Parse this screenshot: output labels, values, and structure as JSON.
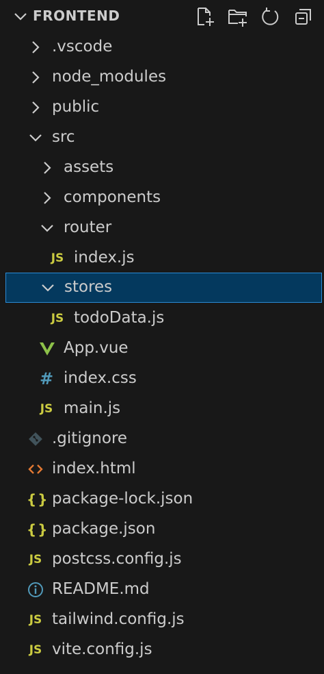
{
  "explorer": {
    "title": "FRONTEND",
    "actions": [
      {
        "icon": "new-file-icon"
      },
      {
        "icon": "new-folder-icon"
      },
      {
        "icon": "refresh-icon"
      },
      {
        "icon": "collapse-all-icon"
      }
    ]
  },
  "tree": [
    {
      "label": ".vscode",
      "type": "folder",
      "expanded": false
    },
    {
      "label": "node_modules",
      "type": "folder",
      "expanded": false
    },
    {
      "label": "public",
      "type": "folder",
      "expanded": false
    },
    {
      "label": "src",
      "type": "folder",
      "expanded": true
    },
    {
      "label": "assets",
      "type": "folder",
      "expanded": false
    },
    {
      "label": "components",
      "type": "folder",
      "expanded": false
    },
    {
      "label": "router",
      "type": "folder",
      "expanded": true
    },
    {
      "label": "index.js",
      "type": "file",
      "icon_text": "JS"
    },
    {
      "label": "stores",
      "type": "folder",
      "expanded": true,
      "selected": true
    },
    {
      "label": "todoData.js",
      "type": "file",
      "icon_text": "JS"
    },
    {
      "label": "App.vue",
      "type": "file",
      "icon": "vue-icon"
    },
    {
      "label": "index.css",
      "type": "file",
      "icon_text": "#"
    },
    {
      "label": "main.js",
      "type": "file",
      "icon_text": "JS"
    },
    {
      "label": ".gitignore",
      "type": "file",
      "icon": "git-icon"
    },
    {
      "label": "index.html",
      "type": "file",
      "icon_text": "<>"
    },
    {
      "label": "package-lock.json",
      "type": "file",
      "icon_text": "{}"
    },
    {
      "label": "package.json",
      "type": "file",
      "icon_text": "{}"
    },
    {
      "label": "postcss.config.js",
      "type": "file",
      "icon_text": "JS"
    },
    {
      "label": "README.md",
      "type": "file",
      "icon": "info-icon"
    },
    {
      "label": "tailwind.config.js",
      "type": "file",
      "icon_text": "JS"
    },
    {
      "label": "vite.config.js",
      "type": "file",
      "icon_text": "JS"
    }
  ],
  "colors": {
    "background": "#181818",
    "selection": "#04395e",
    "selection_border": "#2b8bd6",
    "js": "#cbcb41",
    "css": "#519aba",
    "vue": "#8dc149",
    "html": "#e37933",
    "git": "#41535b",
    "info": "#519aba"
  }
}
